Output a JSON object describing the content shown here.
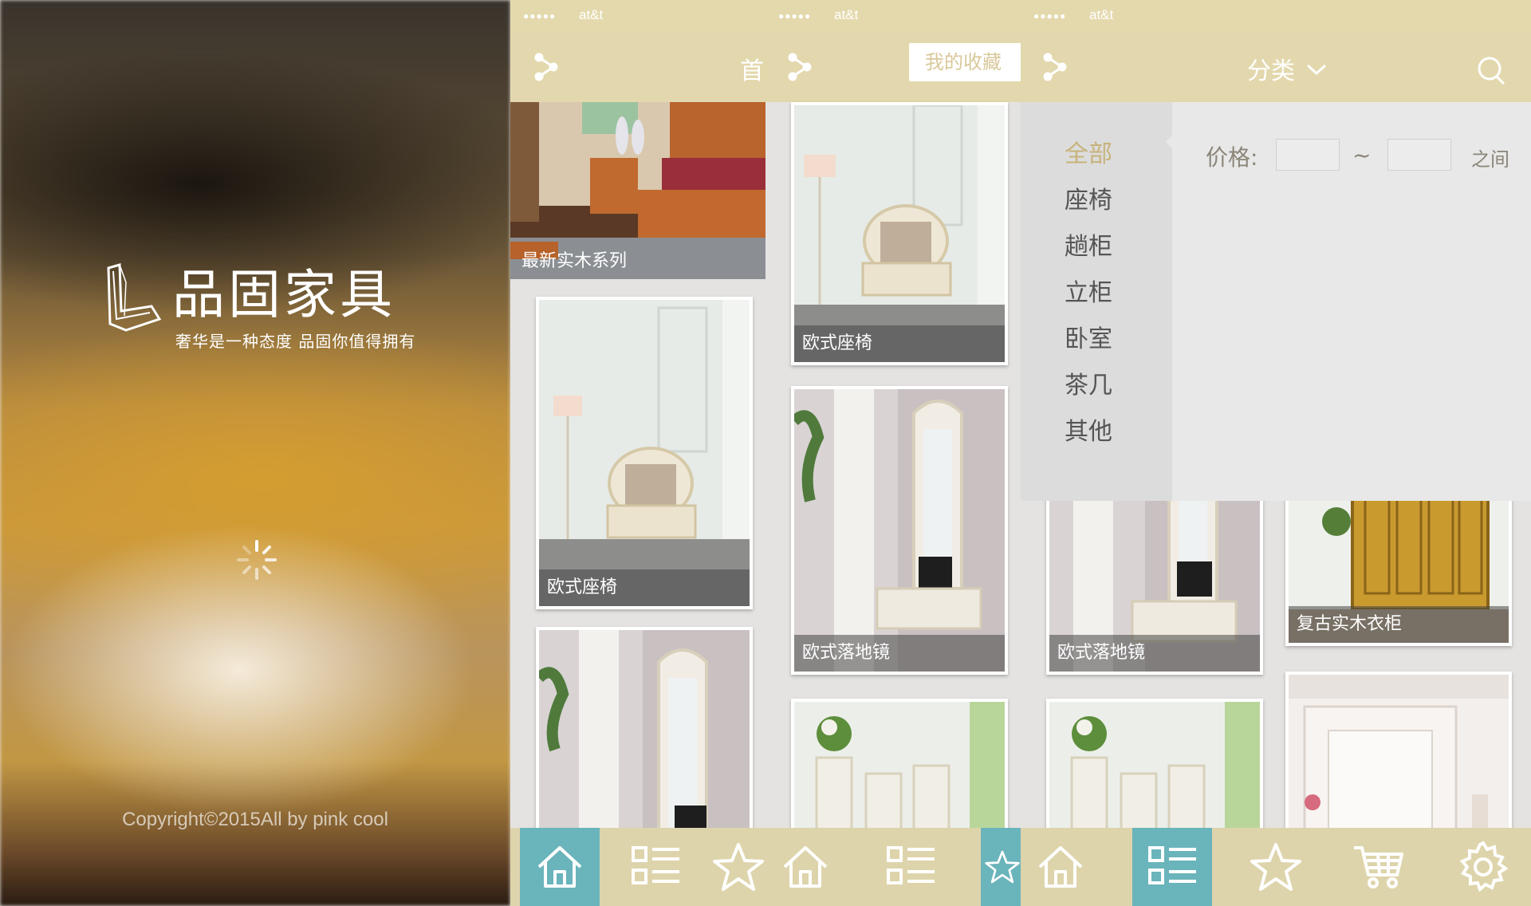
{
  "splash": {
    "brand": "品固家具",
    "slogan": "奢华是一种态度  品固你值得拥有",
    "copyright": "Copyright©2015All by pink cool"
  },
  "status_bar": {
    "signal": "●●●●●",
    "carrier": "at&t"
  },
  "home": {
    "title": "首",
    "hero_caption": "最新实木系列",
    "cards": [
      "欧式座椅"
    ]
  },
  "favorites": {
    "title": "我的收藏",
    "cards": [
      "欧式座椅",
      "欧式落地镜"
    ]
  },
  "category": {
    "title": "分类",
    "items": [
      "全部",
      "座椅",
      "趟柜",
      "立柜",
      "卧室",
      "茶几",
      "其他"
    ],
    "active_item": "全部",
    "price_label": "价格:",
    "price_tilde": "~",
    "price_between": "之间",
    "price_min": "",
    "price_max": "",
    "cards": [
      "欧式落地镜",
      "复古实木衣柜"
    ]
  },
  "tabbar": {
    "tabs": [
      "home-icon",
      "list-icon",
      "star-icon",
      "cart-icon",
      "gear-icon"
    ]
  },
  "colors": {
    "nav": "#e3d8ad",
    "accent": "#6ab4bb",
    "active_category": "#c7b37a"
  }
}
